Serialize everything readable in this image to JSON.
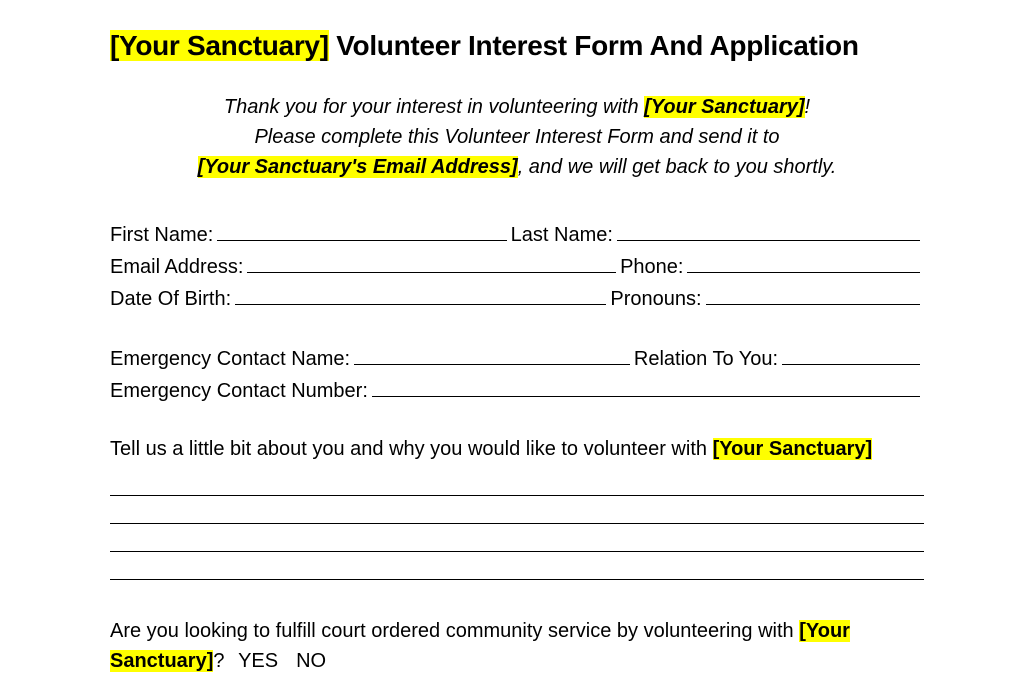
{
  "title": {
    "highlight": "[Your Sanctuary]",
    "rest": " Volunteer Interest Form And Application"
  },
  "intro": {
    "line1a": "Thank you for your interest in volunteering with ",
    "line1b": "[Your Sanctuary]",
    "line1c": "!",
    "line2": "Please complete this Volunteer Interest Form and send it to",
    "line3a": "[Your Sanctuary's Email Address]",
    "line3b": ", and we will get back to you shortly."
  },
  "fields": {
    "first_name": "First Name:",
    "last_name": "Last Name:",
    "email": "Email Address:",
    "phone": "Phone:",
    "dob": "Date Of Birth:",
    "pronouns": "Pronouns: ",
    "emergency_name": "Emergency Contact Name:",
    "relation": "Relation To You:",
    "emergency_number": "Emergency Contact Number:"
  },
  "tell_us": {
    "pre": "Tell us a little bit about you and why you would like to volunteer with ",
    "highlight": "[Your Sanctuary]"
  },
  "question": {
    "pre": "Are you looking to fulfill court ordered community service by volunteering with ",
    "highlight": "[Your Sanctuary]",
    "post": "?",
    "yes": "YES",
    "no": "NO"
  }
}
